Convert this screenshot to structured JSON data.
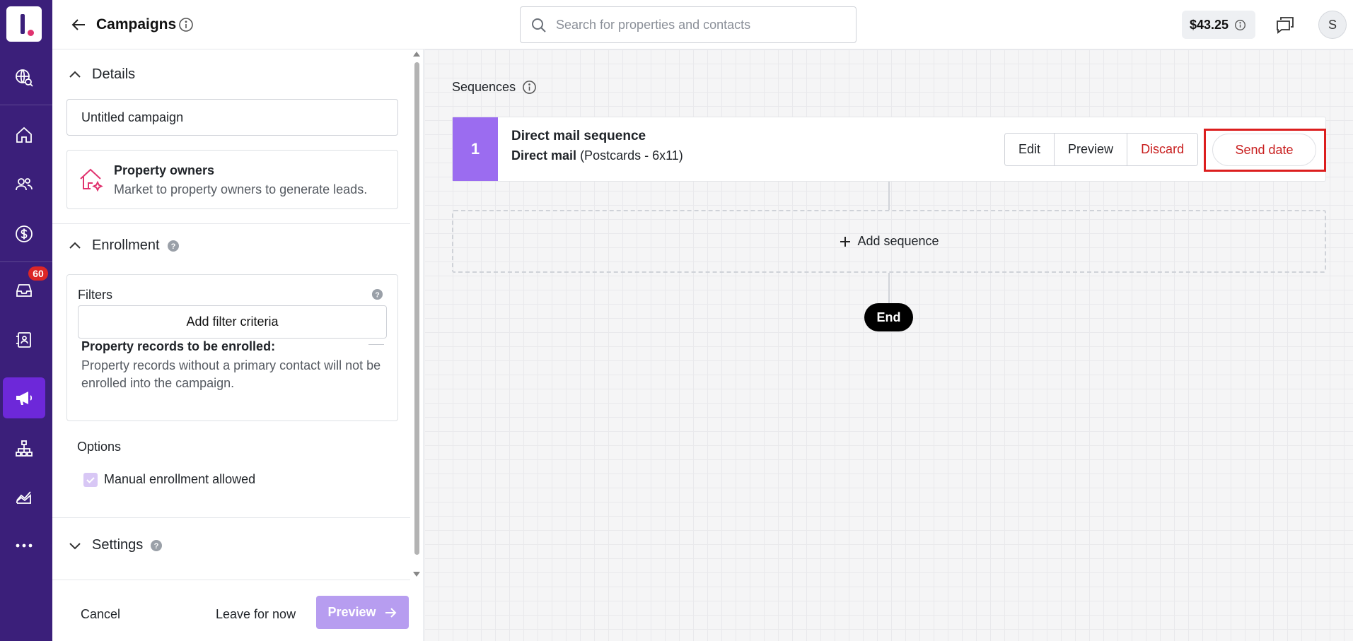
{
  "app": {
    "nav": [
      {
        "id": "globe-search",
        "icon": "globe-search-icon"
      },
      {
        "id": "home",
        "icon": "home-icon"
      },
      {
        "id": "contacts",
        "icon": "users-icon"
      },
      {
        "id": "deals",
        "icon": "dollar-icon"
      },
      {
        "id": "inbox",
        "icon": "inbox-icon",
        "badge": "60"
      },
      {
        "id": "lists",
        "icon": "contact-book-icon"
      },
      {
        "id": "campaigns",
        "icon": "megaphone-icon",
        "active": true
      },
      {
        "id": "workflows",
        "icon": "org-chart-icon"
      },
      {
        "id": "analytics",
        "icon": "chart-icon"
      },
      {
        "id": "more",
        "icon": "more-dots-icon"
      }
    ]
  },
  "header": {
    "title": "Campaigns",
    "search_placeholder": "Search for properties and contacts",
    "balance": "$43.25",
    "avatar_initial": "S"
  },
  "panel": {
    "details": {
      "heading": "Details",
      "campaign_name": "Untitled campaign",
      "audience_title": "Property owners",
      "audience_desc": "Market to property owners to generate leads."
    },
    "enrollment": {
      "heading": "Enrollment",
      "filters_label": "Filters",
      "add_filter_label": "Add filter criteria",
      "enrolled_label": "Property records to be enrolled:",
      "note": "Property records without a primary contact will not be enrolled into the campaign."
    },
    "options": {
      "heading": "Options",
      "manual_enrollment_label": "Manual enrollment allowed",
      "manual_enrollment_checked": true
    },
    "settings": {
      "heading": "Settings"
    },
    "footer": {
      "cancel_label": "Cancel",
      "leave_label": "Leave for now",
      "preview_label": "Preview"
    }
  },
  "canvas": {
    "sequences_label": "Sequences",
    "sequences": [
      {
        "number": "1",
        "title": "Direct mail sequence",
        "channel": "Direct mail",
        "format": "(Postcards - 6x11)",
        "actions": {
          "edit": "Edit",
          "preview": "Preview",
          "discard": "Discard",
          "send_date": "Send date"
        }
      }
    ],
    "add_sequence_label": "Add sequence",
    "end_label": "End"
  },
  "colors": {
    "rail": "#3b1f7a",
    "accent": "#6d28d9",
    "sequence_number_bg": "#9b6cf0",
    "danger": "#c81e1e",
    "highlight": "#dc1e1e",
    "preview_button": "#b79df0"
  }
}
